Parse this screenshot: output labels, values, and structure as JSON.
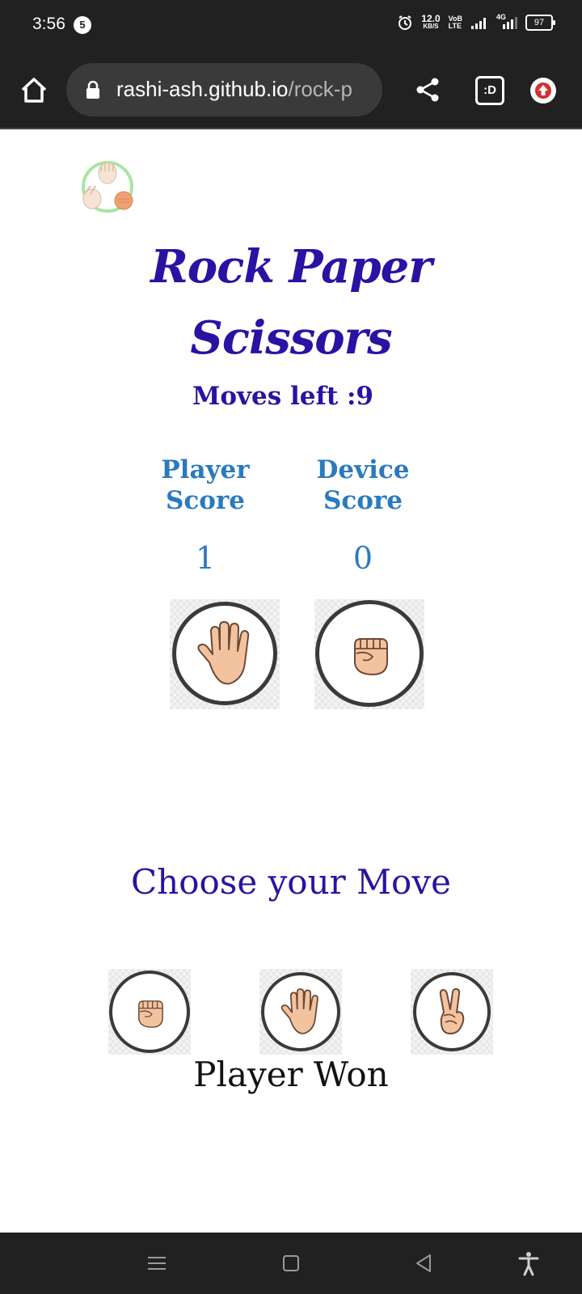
{
  "status_bar": {
    "time": "3:56",
    "notification_count": "5",
    "net_speed_value": "12.0",
    "net_speed_unit": "KB/S",
    "volte_top": "VoB",
    "volte_bottom": "LTE",
    "network_type": "4G",
    "battery": "97"
  },
  "browser": {
    "url_host": "rashi-ash.github.io",
    "url_path": "/rock-p",
    "tab_label": ":D"
  },
  "game": {
    "title_line1": "Rock Paper",
    "title_line2": "Scissors",
    "moves_left": "Moves left :9",
    "player_score_label_1": "Player",
    "player_score_label_2": "Score",
    "device_score_label_1": "Device",
    "device_score_label_2": "Score",
    "player_score": "1",
    "device_score": "0",
    "player_choice_icon": "paper-hand-icon",
    "device_choice_icon": "rock-fist-icon",
    "choose_prompt": "Choose your Move",
    "options": [
      {
        "name": "rock",
        "icon": "rock-fist-icon"
      },
      {
        "name": "paper",
        "icon": "paper-hand-icon"
      },
      {
        "name": "scissors",
        "icon": "scissors-hand-icon"
      }
    ],
    "result": "Player Won"
  },
  "colors": {
    "title": "#2a12a3",
    "score": "#2a7abf",
    "skin": "#f3c3a0",
    "skin_outline": "#6b4a35",
    "chrome_dark": "#212121"
  }
}
